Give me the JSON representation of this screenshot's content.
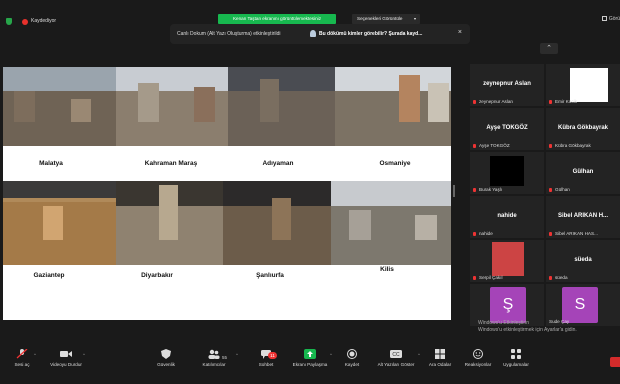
{
  "topbar": {
    "recording_label": "Kaydediyor",
    "share_banner": "Kenan Taştan ekranını görüntülemektesiniz",
    "view_options": "Seçenekleri Görüntüle",
    "gallery_label": "Görü"
  },
  "caption_notice": {
    "text": "Canlı Dokum (Alt Yazı Oluşturma) etkinleştirildi",
    "highlight": "Bu dökümü kimler görebilir? Şurada kayd..."
  },
  "slide": {
    "cities": [
      "Malatya",
      "Kahraman Maraş",
      "Adıyaman",
      "Osmaniye",
      "Gaziantep",
      "Diyarbakır",
      "Şanlıurfa",
      "Kilis"
    ]
  },
  "participants": [
    {
      "display": "zeynepnur Aslan",
      "label": "zeynepnur Aslan",
      "muted": true,
      "kind": "name"
    },
    {
      "display": "",
      "label": "Emir Kocik",
      "muted": true,
      "kind": "white-video"
    },
    {
      "display": "Ayşe TOKGÖZ",
      "label": "Ayşe TOKGÖZ",
      "muted": true,
      "kind": "name"
    },
    {
      "display": "Kübra Gökbayrak",
      "label": "Kübra Gökbayrak",
      "muted": true,
      "kind": "name"
    },
    {
      "display": "",
      "label": "Burak Yaşlı",
      "muted": true,
      "kind": "black-video"
    },
    {
      "display": "Gülhan",
      "label": "Gülhan",
      "muted": true,
      "kind": "name"
    },
    {
      "display": "nahide",
      "label": "nahide",
      "muted": true,
      "kind": "name"
    },
    {
      "display": "Sibel ARIKAN H...",
      "label": "Sibel ARIKAN HAS...",
      "muted": true,
      "kind": "name"
    },
    {
      "display": "",
      "label": "Serpil Çakıl",
      "muted": true,
      "kind": "person-video"
    },
    {
      "display": "süeda",
      "label": "süeda",
      "muted": true,
      "kind": "name"
    },
    {
      "display": "Ş",
      "label": "",
      "muted": false,
      "kind": "avatar"
    },
    {
      "display": "S",
      "label": "Sude Çay",
      "muted": false,
      "kind": "avatar"
    }
  ],
  "watermark": {
    "line1": "Windows'u Etkinleştirin",
    "line2": "Windows'u etkinleştirmek için Ayarlar'a gidin."
  },
  "toolbar": {
    "audio": "Sesi aç",
    "video": "Videoyu Durdur",
    "security": "Güvenlik",
    "participants": "Katılımcılar",
    "participants_count": "55",
    "chat": "Sohbet",
    "chat_badge": "11",
    "share": "Ekranı Paylaşma",
    "record": "Kaydet",
    "captions": "Alt Yazıları Göster",
    "breakout": "Ara Odalar",
    "reactions": "Reaksiyonlar",
    "apps": "Uygulamalar"
  },
  "colors": {
    "share_green": "#17b84f",
    "leave_red": "#d42b2b",
    "avatar_purple": "#a544b8"
  }
}
